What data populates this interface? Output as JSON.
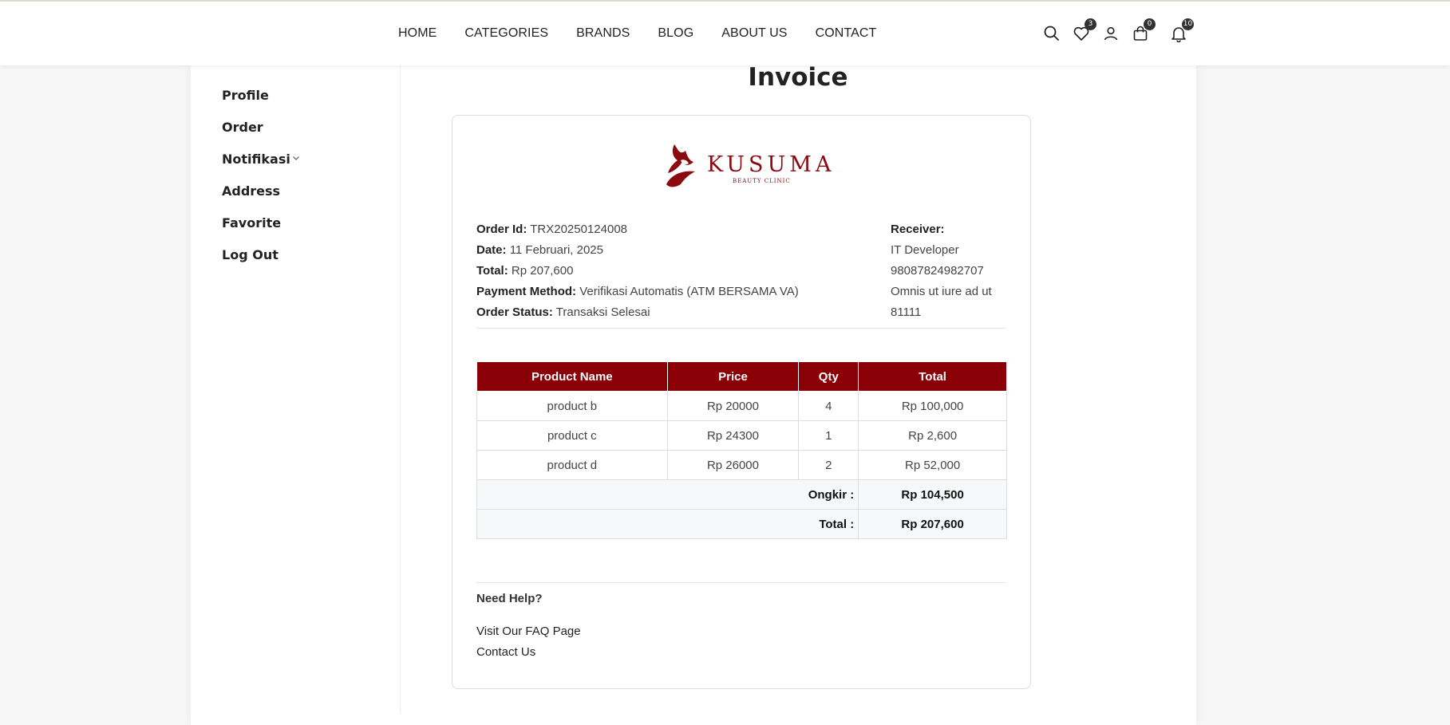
{
  "nav": {
    "items": [
      "HOME",
      "CATEGORIES",
      "BRANDS",
      "BLOG",
      "ABOUT US",
      "CONTACT"
    ]
  },
  "header_icons": {
    "wishlist_count": "3",
    "cart_count": "0",
    "notification_count": "10"
  },
  "sidebar": {
    "items": [
      "Profile",
      "Order",
      "Notifikasi",
      "Address",
      "Favorite",
      "Log Out"
    ]
  },
  "page": {
    "title": "Invoice"
  },
  "brand": {
    "name": "KUSUMA",
    "tagline": "BEAUTY CLINIC",
    "color": "#8b0a10"
  },
  "order": {
    "id_label": "Order Id:",
    "id": "TRX20250124008",
    "date_label": "Date:",
    "date": "11 Februari, 2025",
    "total_label": "Total:",
    "total": "Rp 207,600",
    "payment_label": "Payment Method:",
    "payment": "Verifikasi Automatis (ATM BERSAMA VA)",
    "status_label": "Order Status:",
    "status": "Transaksi Selesai"
  },
  "receiver": {
    "label": "Receiver:",
    "name": "IT Developer",
    "phone": "98087824982707",
    "address": "Omnis ut iure ad ut",
    "postal": "81111"
  },
  "table": {
    "headers": [
      "Product Name",
      "Price",
      "Qty",
      "Total"
    ],
    "rows": [
      [
        "product b",
        "Rp 20000",
        "4",
        "Rp 100,000"
      ],
      [
        "product c",
        "Rp 24300",
        "1",
        "Rp 2,600"
      ],
      [
        "product d",
        "Rp 26000",
        "2",
        "Rp 52,000"
      ]
    ],
    "ongkir_label": "Ongkir :",
    "ongkir": "Rp 104,500",
    "total_label": "Total :",
    "total": "Rp 207,600"
  },
  "help": {
    "title": "Need Help?",
    "faq": "Visit Our FAQ Page",
    "contact": "Contact Us"
  },
  "colors": {
    "accent": "#8b0007"
  }
}
